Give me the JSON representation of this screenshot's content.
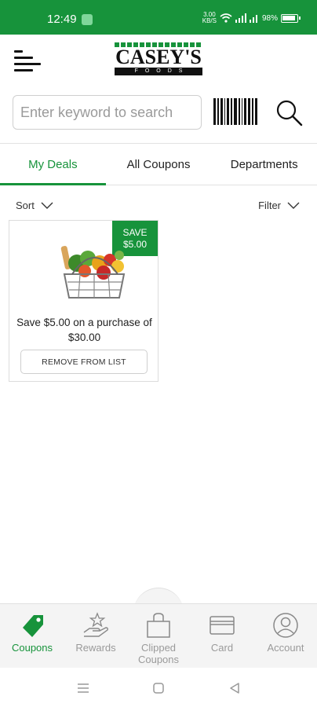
{
  "status_bar": {
    "time": "12:49",
    "speed_value": "3.00",
    "speed_unit": "KB/S",
    "battery": "98%"
  },
  "header": {
    "logo_text": "CASEY'S",
    "logo_subtext": "FOODS",
    "has_notification_dot": true
  },
  "search": {
    "placeholder": "Enter keyword to search"
  },
  "tabs": [
    {
      "label": "My Deals",
      "active": true
    },
    {
      "label": "All Coupons",
      "active": false
    },
    {
      "label": "Departments",
      "active": false
    }
  ],
  "toolbar": {
    "sort_label": "Sort",
    "filter_label": "Filter"
  },
  "deals": [
    {
      "badge_line1": "SAVE",
      "badge_line2": "$5.00",
      "description": "Save $5.00 on a purchase of $30.00",
      "button_label": "REMOVE FROM LIST",
      "image_icon": "grocery-basket-icon"
    }
  ],
  "bottom_nav": [
    {
      "label": "Coupons",
      "icon": "tag-icon",
      "active": true
    },
    {
      "label": "Rewards",
      "icon": "rewards-hand-star-icon",
      "active": false
    },
    {
      "label": "Clipped Coupons",
      "icon": "clipped-bag-icon",
      "active": false
    },
    {
      "label": "Card",
      "icon": "card-icon",
      "active": false
    },
    {
      "label": "Account",
      "icon": "account-icon",
      "active": false
    }
  ],
  "colors": {
    "brand_green": "#17933b",
    "inactive_gray": "#9a9a9a"
  }
}
